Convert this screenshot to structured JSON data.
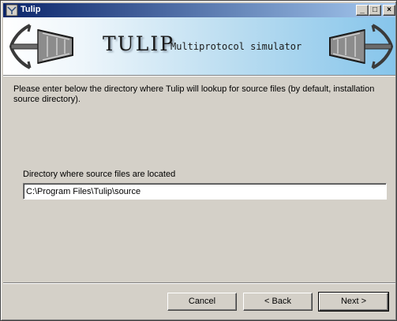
{
  "window": {
    "title": "Tulip"
  },
  "banner": {
    "title": "TULIP",
    "subtitle": "Multiprotocol simulator"
  },
  "main": {
    "instructions": "Please enter below the directory where Tulip will lookup for source files (by default, installation source directory).",
    "dir_label": "Directory where source files are located",
    "dir_value": "C:\\Program Files\\Tulip\\source"
  },
  "buttons": {
    "cancel": "Cancel",
    "back": "Back",
    "next": "Next"
  }
}
